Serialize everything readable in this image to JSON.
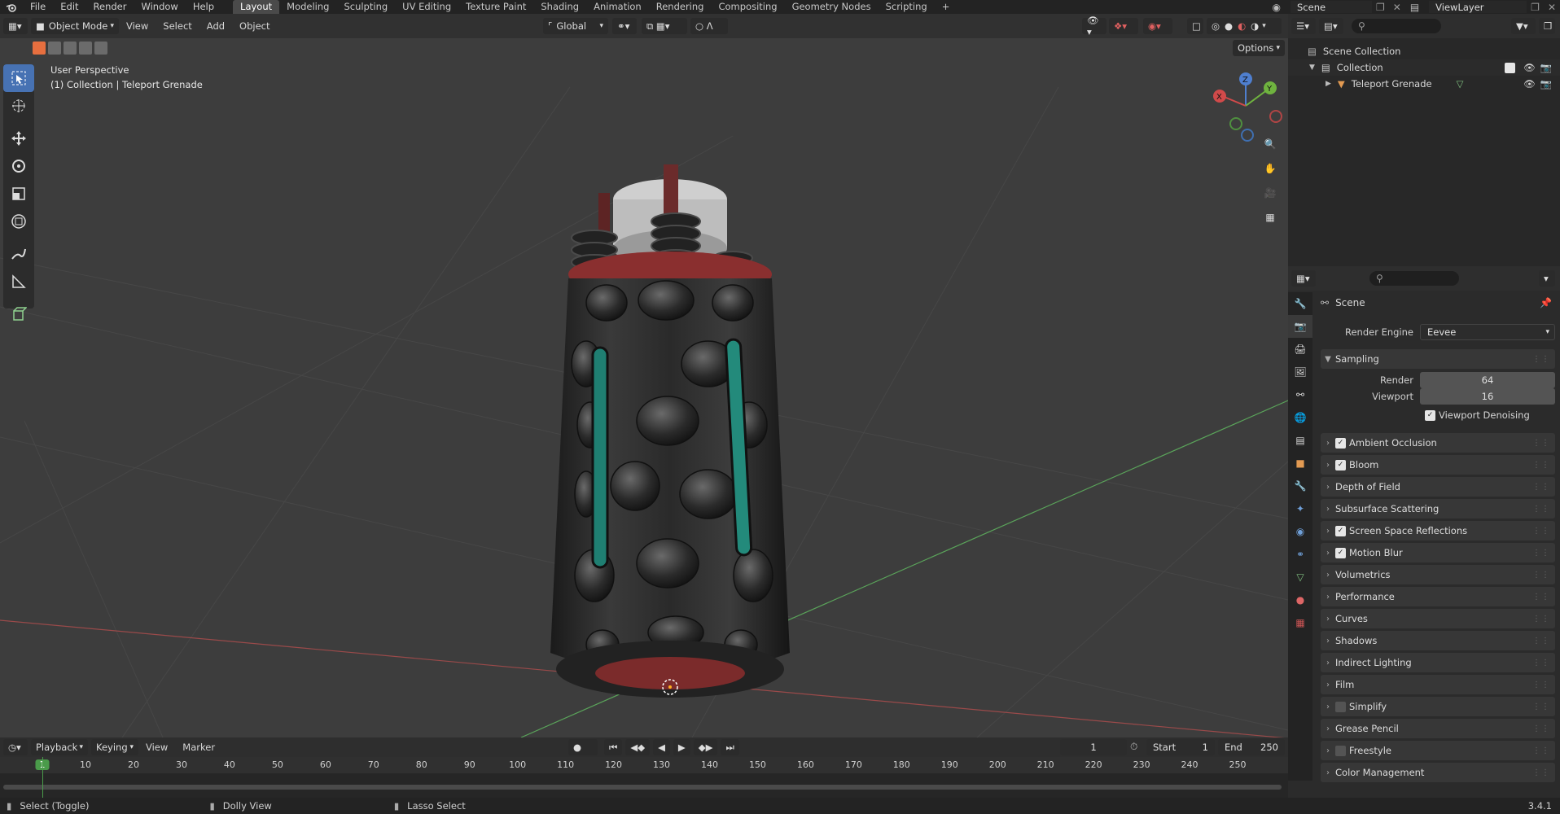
{
  "topbar": {
    "menus": [
      "File",
      "Edit",
      "Render",
      "Window",
      "Help"
    ],
    "workspaces": [
      "Layout",
      "Modeling",
      "Sculpting",
      "UV Editing",
      "Texture Paint",
      "Shading",
      "Animation",
      "Rendering",
      "Compositing",
      "Geometry Nodes",
      "Scripting"
    ],
    "active_workspace": "Layout",
    "scene_name": "Scene",
    "view_layer": "ViewLayer"
  },
  "viewport": {
    "mode": "Object Mode",
    "menus": [
      "View",
      "Select",
      "Add",
      "Object"
    ],
    "transform_orientation": "Global",
    "options_label": "Options",
    "perspective_label": "User Perspective",
    "collection_label": "(1) Collection | Teleport Grenade",
    "gizmo_axes": {
      "x": "X",
      "y": "Y",
      "z": "Z"
    }
  },
  "outliner": {
    "root": "Scene Collection",
    "collection": "Collection",
    "object": "Teleport Grenade"
  },
  "properties": {
    "context": "Scene",
    "render_engine_label": "Render Engine",
    "render_engine": "Eevee",
    "sampling": {
      "title": "Sampling",
      "render_label": "Render",
      "render_value": "64",
      "viewport_label": "Viewport",
      "viewport_value": "16",
      "denoise_label": "Viewport Denoising"
    },
    "panels": [
      {
        "label": "Ambient Occlusion",
        "checkbox": true,
        "checked": true
      },
      {
        "label": "Bloom",
        "checkbox": true,
        "checked": true
      },
      {
        "label": "Depth of Field",
        "checkbox": false
      },
      {
        "label": "Subsurface Scattering",
        "checkbox": false
      },
      {
        "label": "Screen Space Reflections",
        "checkbox": true,
        "checked": true
      },
      {
        "label": "Motion Blur",
        "checkbox": true,
        "checked": true
      },
      {
        "label": "Volumetrics",
        "checkbox": false
      },
      {
        "label": "Performance",
        "checkbox": false
      },
      {
        "label": "Curves",
        "checkbox": false
      },
      {
        "label": "Shadows",
        "checkbox": false
      },
      {
        "label": "Indirect Lighting",
        "checkbox": false
      },
      {
        "label": "Film",
        "checkbox": false
      },
      {
        "label": "Simplify",
        "checkbox": true,
        "checked": false
      },
      {
        "label": "Grease Pencil",
        "checkbox": false
      },
      {
        "label": "Freestyle",
        "checkbox": true,
        "checked": false
      },
      {
        "label": "Color Management",
        "checkbox": false
      }
    ]
  },
  "timeline": {
    "menus": [
      "Playback",
      "Keying",
      "View",
      "Marker"
    ],
    "current_frame": "1",
    "start_label": "Start",
    "start": "1",
    "end_label": "End",
    "end": "250",
    "ruler": [
      "1",
      "10",
      "20",
      "30",
      "40",
      "50",
      "60",
      "70",
      "80",
      "90",
      "100",
      "110",
      "120",
      "130",
      "140",
      "150",
      "160",
      "170",
      "180",
      "190",
      "200",
      "210",
      "220",
      "230",
      "240",
      "250"
    ]
  },
  "statusbar": {
    "items": [
      "Select (Toggle)",
      "Dolly View",
      "Lasso Select"
    ],
    "version": "3.4.1"
  }
}
